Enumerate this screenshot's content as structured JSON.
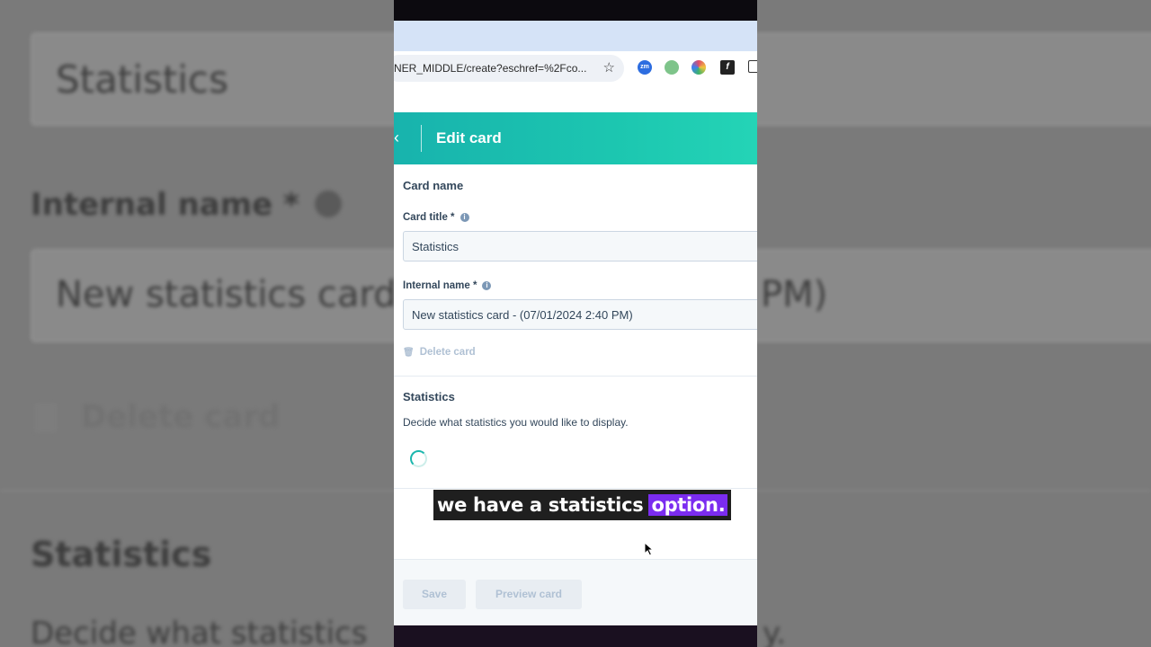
{
  "browser": {
    "url": "NER_MIDDLE/create?eschref=%2Fco...",
    "bookmark_icon": "star-icon",
    "extensions": [
      {
        "name": "zoom-extension-icon",
        "label": "zm",
        "color": "#2d6de0"
      },
      {
        "name": "frog-extension-icon",
        "label": "",
        "color": "#7ec48a"
      },
      {
        "name": "color-wheel-extension-icon",
        "label": "",
        "color": "#e04b6a"
      },
      {
        "name": "fx-extension-icon",
        "label": "f",
        "color": "#222222"
      }
    ]
  },
  "header": {
    "back_icon": "chevron-left-icon",
    "title": "Edit card",
    "colors": {
      "start": "#18b3ad",
      "end": "#24d4b6"
    }
  },
  "card_name": {
    "section_title": "Card name",
    "card_title_label": "Card title *",
    "card_title_value": "Statistics",
    "internal_name_label": "Internal name *",
    "internal_name_value": "New statistics card - (07/01/2024 2:40 PM)",
    "delete_label": "Delete card"
  },
  "statistics": {
    "section_title": "Statistics",
    "description": "Decide what statistics you would like to display."
  },
  "caption": {
    "text": "we have a statistics",
    "highlight": "option."
  },
  "footer": {
    "save_label": "Save",
    "preview_label": "Preview card"
  },
  "background_zoom": {
    "title_value": "Statistics",
    "internal_name_label": "Internal name *",
    "internal_name_value": "New statistics card",
    "internal_name_value_tail": "PM)",
    "delete_label": "Delete card",
    "section_title": "Statistics",
    "description": "Decide what statistics",
    "description_tail": "y."
  }
}
